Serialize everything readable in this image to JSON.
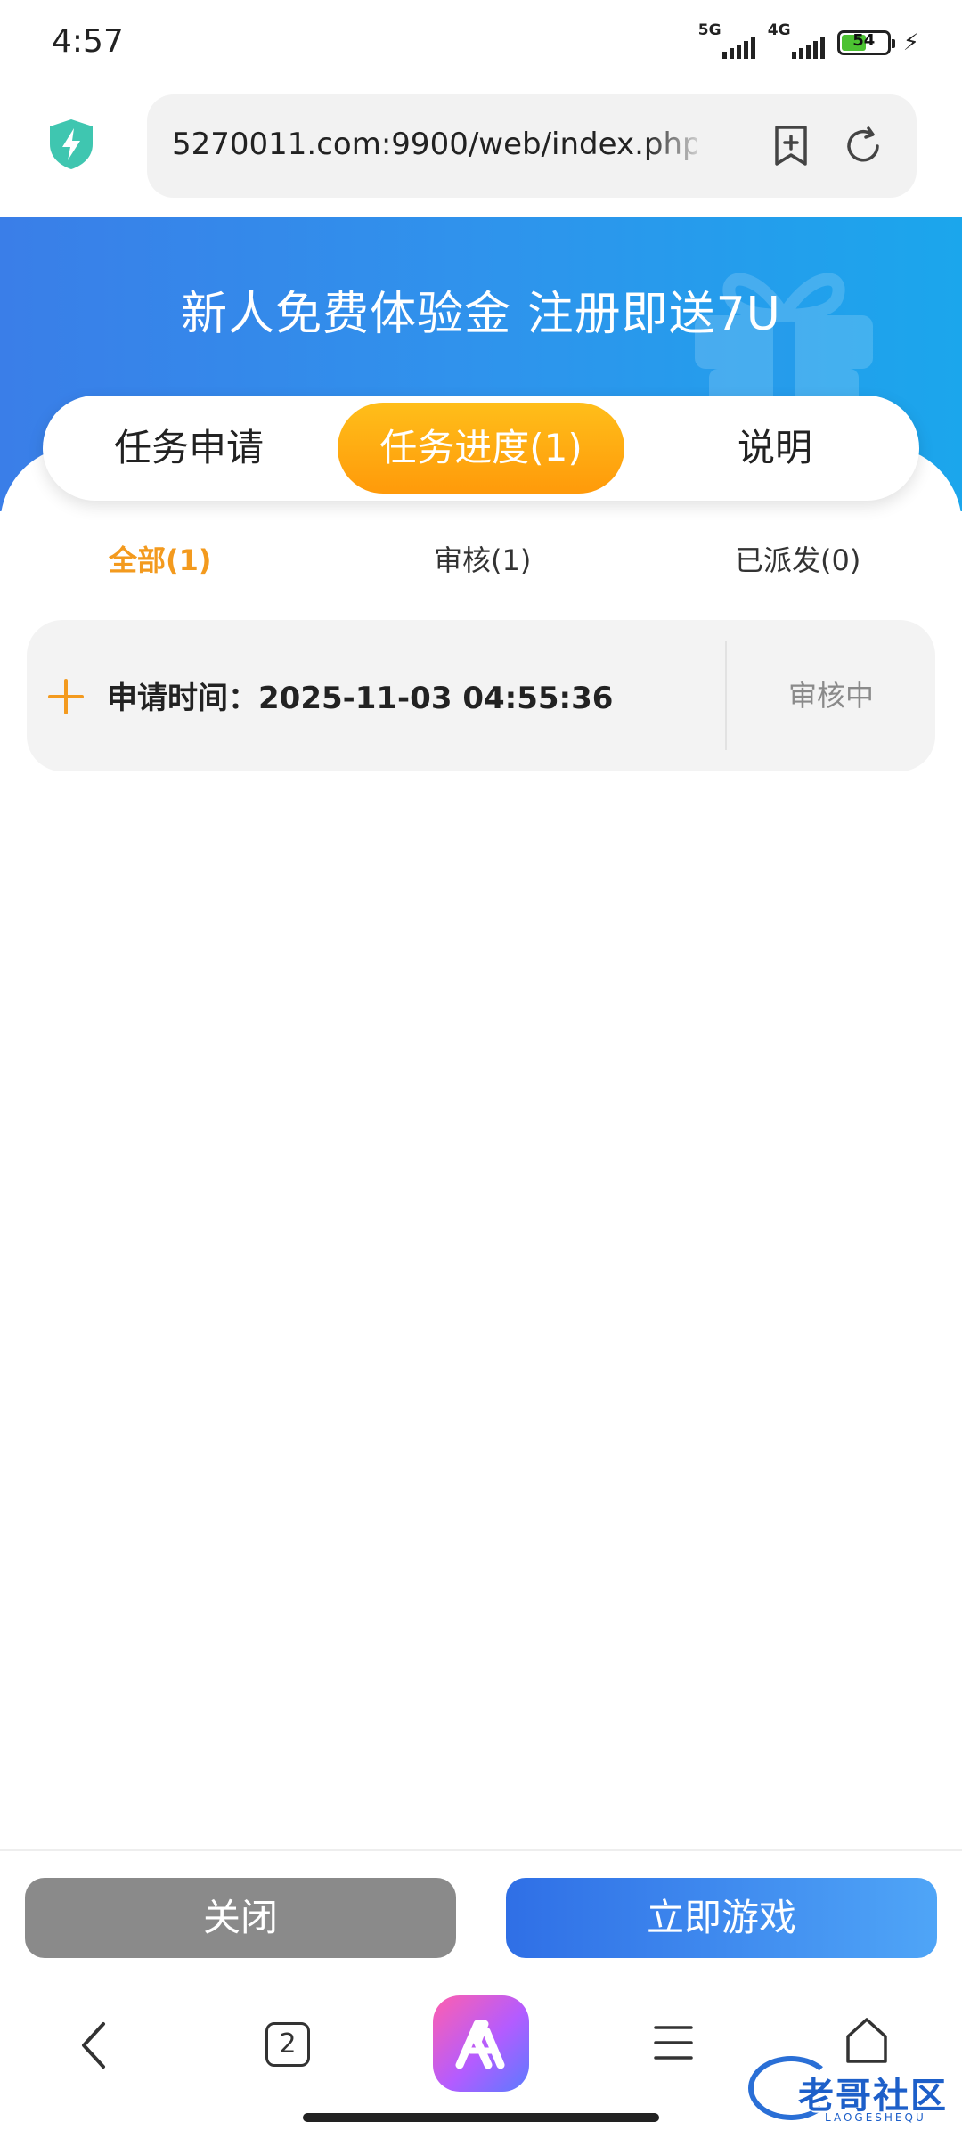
{
  "status_bar": {
    "time": "4:57",
    "network1": "5G",
    "network2": "4G",
    "battery": "54",
    "battery_level": 0.54
  },
  "browser": {
    "url": "5270011.com:9900/web/index.php",
    "tab_count": "2"
  },
  "banner": {
    "title": "新人免费体验金 注册即送7U"
  },
  "main_tabs": [
    {
      "label": "任务申请",
      "active": false
    },
    {
      "label": "任务进度(1)",
      "active": true
    },
    {
      "label": "说明",
      "active": false
    }
  ],
  "sub_tabs": [
    {
      "label": "全部(1)",
      "active": true
    },
    {
      "label": "审核(1)",
      "active": false
    },
    {
      "label": "已派发(0)",
      "active": false
    }
  ],
  "record": {
    "label": "申请时间：2025-11-03 04:55:36",
    "status": "审核中"
  },
  "actions": {
    "close": "关闭",
    "play": "立即游戏"
  },
  "watermark": {
    "text": "老哥社区",
    "sub": "LAOGESHEQU"
  },
  "colors": {
    "accent_orange": "#ff9a0a",
    "banner_blue": "#2f93ec",
    "play_blue": "#2f6fe6",
    "close_gray": "#8a8a8a"
  }
}
